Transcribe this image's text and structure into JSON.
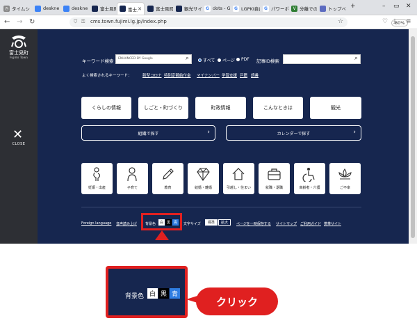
{
  "browser": {
    "tabs": [
      {
        "label": "タイムシ",
        "icon": "clock-icon",
        "color": "#888888"
      },
      {
        "label": "deskne",
        "icon": "desknets-icon",
        "color": "#3b82f6"
      },
      {
        "label": "deskne",
        "icon": "desknets-icon",
        "color": "#3b82f6"
      },
      {
        "label": "富士見町",
        "icon": "fujimi-icon",
        "color": "#16264f"
      },
      {
        "label": "富士見",
        "icon": "fujimi-icon",
        "color": "#16264f",
        "active": true
      },
      {
        "label": "富士見町",
        "icon": "fujimi-icon",
        "color": "#16264f"
      },
      {
        "label": "観光サイ",
        "icon": "fujimi-icon",
        "color": "#16264f"
      },
      {
        "label": "dots - G",
        "icon": "google-icon",
        "color": "#ffffff"
      },
      {
        "label": "LGPKI自己",
        "icon": "google-icon",
        "color": "#ffffff"
      },
      {
        "label": "パワーポ",
        "icon": "google-icon",
        "color": "#ffffff"
      },
      {
        "label": "分離での",
        "icon": "v-icon",
        "color": "#2e7d32"
      },
      {
        "label": "トップペ",
        "icon": "globe-icon",
        "color": "#5c6bc0"
      }
    ],
    "url": "cms.town.fujimi.lg.jp/index.php",
    "zoom": "80%"
  },
  "site": {
    "logo_name": "富士見町",
    "logo_sub": "Fujimi Town",
    "close_label": "CLOSE"
  },
  "search": {
    "keyword_label": "キーワード検索",
    "google_badge": "ENHANCED BY Google",
    "radio_all": "すべて",
    "radio_page": "ページ",
    "radio_pdf": "PDF",
    "article_id_label": "記事ID検索"
  },
  "keywords": {
    "label": "よく検索されるキーワード：",
    "items": [
      "新型コロナ",
      "特別定額給付金",
      "マイナンバー",
      "学習支援",
      "戸籍",
      "読書"
    ]
  },
  "categories": [
    "くらしの情報",
    "しごと・町づくり",
    "町政情報",
    "こんなときは",
    "観光"
  ],
  "wide_buttons": {
    "org": "組織で探す",
    "calendar": "カレンダーで探す"
  },
  "life_events": [
    {
      "label": "妊娠・出産",
      "icon": "pregnancy-icon"
    },
    {
      "label": "子育て",
      "icon": "child-icon"
    },
    {
      "label": "教育",
      "icon": "pencil-icon"
    },
    {
      "label": "結婚・離婚",
      "icon": "diamond-icon"
    },
    {
      "label": "引越し・住まい",
      "icon": "house-icon"
    },
    {
      "label": "就職・退職",
      "icon": "briefcase-icon"
    },
    {
      "label": "高齢者・介護",
      "icon": "wheelchair-icon"
    },
    {
      "label": "ご不幸",
      "icon": "lotus-icon"
    }
  ],
  "footer": {
    "foreign_language": "Foreign language",
    "read_aloud": "音声読み上げ",
    "bg_color_label": "背景色",
    "bg_white": "白",
    "bg_black": "黒",
    "bg_blue": "青",
    "text_size_label": "文字サイズ",
    "size_standard": "標準",
    "size_large": "拡大",
    "temp_save": "ページを一時保存する",
    "sitemap": "サイトマップ",
    "usage_guide": "ご利用ガイド",
    "site_list": "携帯サイト"
  },
  "callout": {
    "bg_color_label": "背景色",
    "bg_white": "白",
    "bg_black": "黒",
    "bg_blue": "青",
    "click_label": "クリック"
  },
  "colors": {
    "navy": "#16264f",
    "accent_red": "#e02020",
    "bg_blue_swatch": "#2f7de1"
  }
}
